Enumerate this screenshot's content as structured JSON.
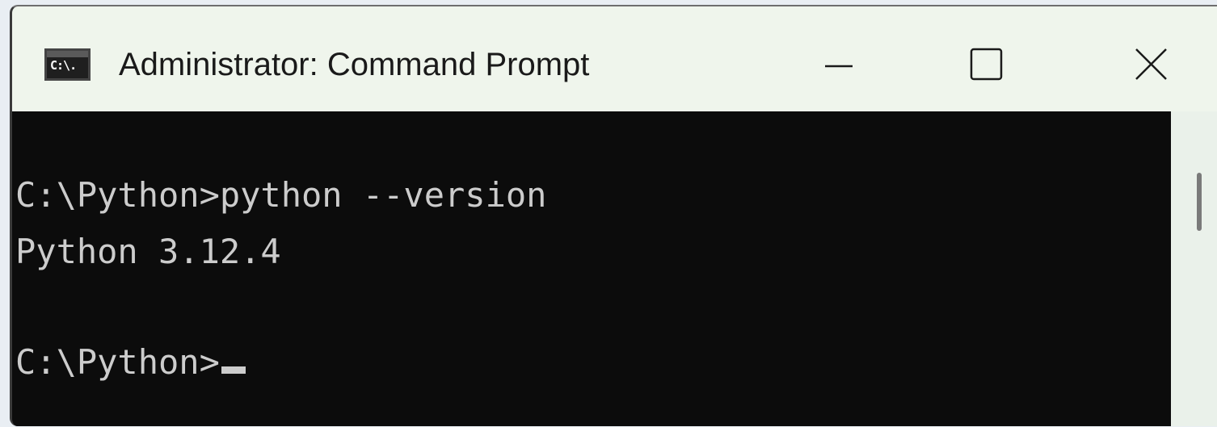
{
  "window": {
    "title": "Administrator: Command Prompt",
    "icon": "cmd-icon",
    "icon_text": "C:\\."
  },
  "controls": {
    "minimize": "minimize-icon",
    "maximize": "maximize-icon",
    "close": "close-icon"
  },
  "console": {
    "lines": [
      "C:\\Python>python --version",
      "Python 3.12.4",
      "C:\\Python>"
    ]
  },
  "colors": {
    "titlebar_bg": "#eff5ec",
    "console_bg": "#0c0c0c",
    "console_fg": "#cccccc"
  }
}
